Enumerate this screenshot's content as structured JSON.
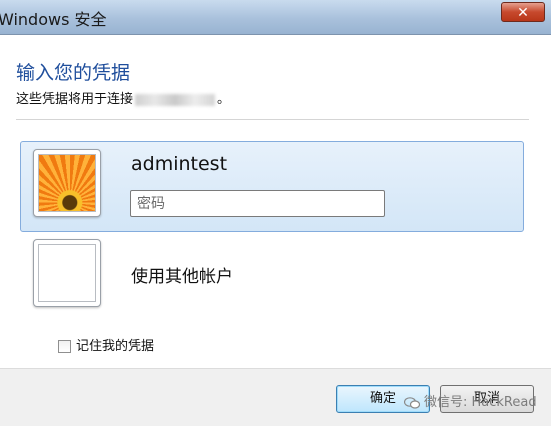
{
  "window": {
    "title": "Windows 安全",
    "close_glyph": "✕"
  },
  "dialog": {
    "heading": "输入您的凭据",
    "subtext_prefix": "这些凭据将用于连接",
    "subtext_suffix": "。"
  },
  "accounts": [
    {
      "username": "admintest",
      "password_placeholder": "密码",
      "avatar": "flower-avatar-icon"
    },
    {
      "label": "使用其他帐户",
      "avatar": "blank-avatar-icon"
    }
  ],
  "remember_label": "记住我的凭据",
  "buttons": {
    "ok": "确定",
    "cancel": "取消"
  },
  "watermark": "微信号: HackRead",
  "colors": {
    "heading": "#1f4e9c",
    "selection": "#d3e6f7",
    "close": "#c7492d"
  }
}
